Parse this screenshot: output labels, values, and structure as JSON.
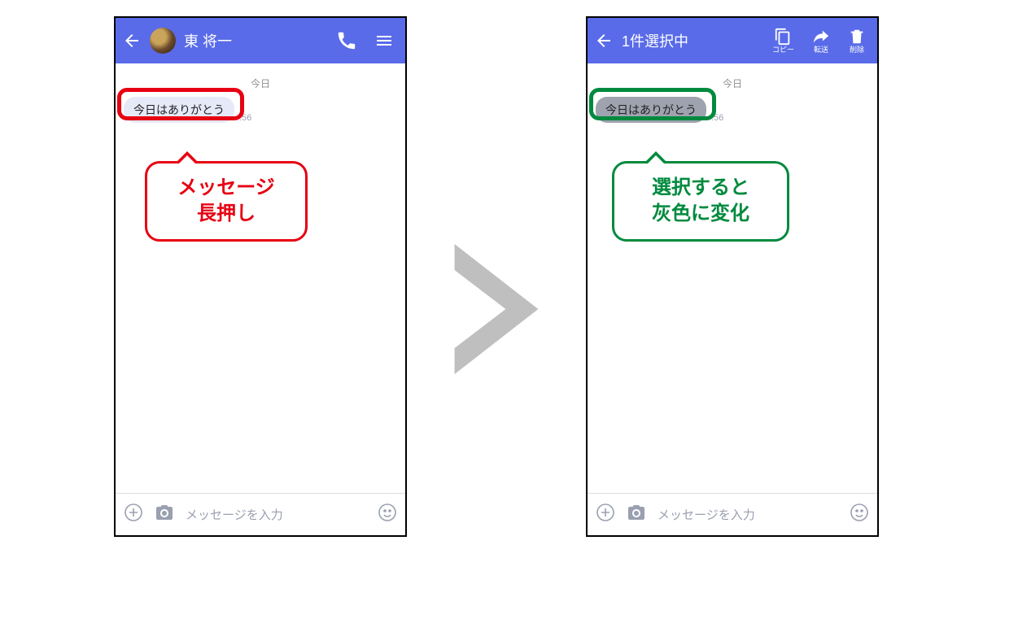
{
  "left": {
    "header": {
      "title": "東 将一"
    },
    "chat": {
      "date": "今日",
      "message": "今日はありがとう",
      "time": ":56"
    },
    "callout": "メッセージ\n長押し",
    "input_placeholder": "メッセージを入力"
  },
  "right": {
    "header": {
      "title": "1件選択中",
      "actions": {
        "copy": "コピー",
        "forward": "転送",
        "delete": "削除"
      }
    },
    "chat": {
      "date": "今日",
      "message": "今日はありがとう",
      "time": ":56"
    },
    "callout": "選択すると\n灰色に変化",
    "input_placeholder": "メッセージを入力"
  },
  "colors": {
    "accent": "#596be8",
    "highlight_red": "#e60012",
    "highlight_green": "#008a3e"
  }
}
